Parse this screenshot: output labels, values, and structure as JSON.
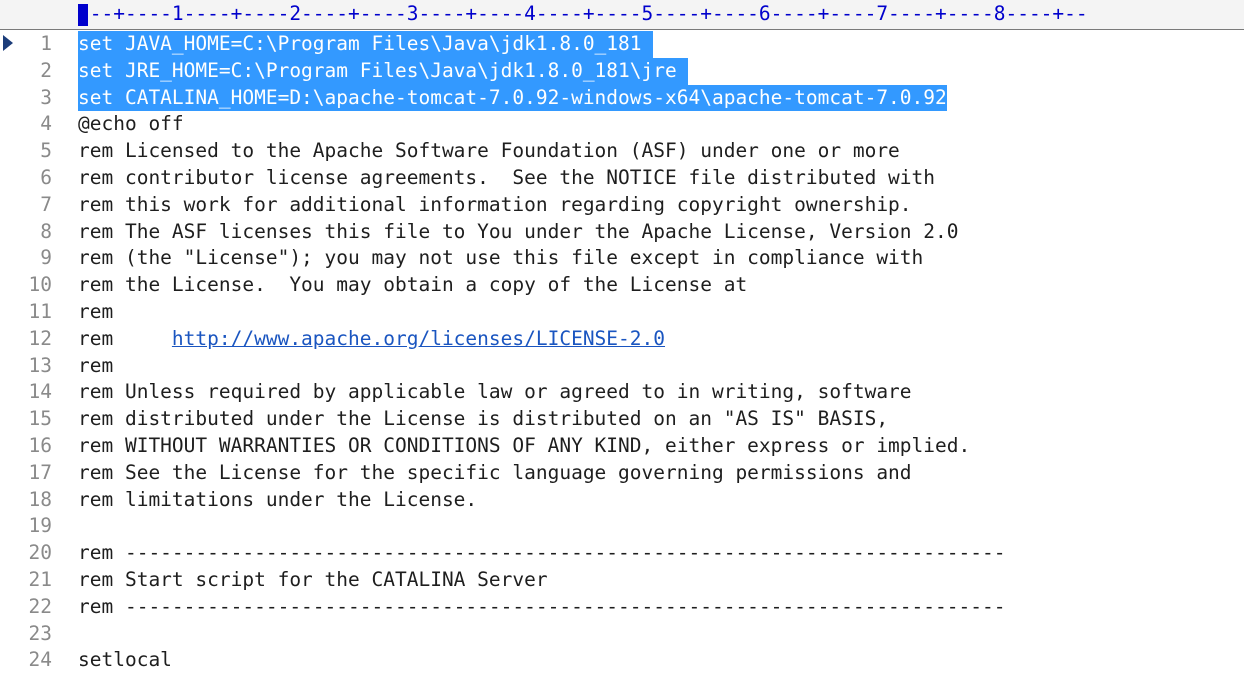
{
  "ruler": {
    "text": "---+----1----+----2----+----3----+----4----+----5----+----6----+----7----+----8----+--"
  },
  "lines": [
    {
      "num": "1",
      "text": "set JAVA_HOME=C:\\Program Files\\Java\\jdk1.8.0_181 ",
      "selected": true
    },
    {
      "num": "2",
      "text": "set JRE_HOME=C:\\Program Files\\Java\\jdk1.8.0_181\\jre ",
      "selected": true
    },
    {
      "num": "3",
      "text": "set CATALINA_HOME=D:\\apache-tomcat-7.0.92-windows-x64\\apache-tomcat-7.0.92",
      "selected": true
    },
    {
      "num": "4",
      "text": "@echo off"
    },
    {
      "num": "5",
      "text": "rem Licensed to the Apache Software Foundation (ASF) under one or more"
    },
    {
      "num": "6",
      "text": "rem contributor license agreements.  See the NOTICE file distributed with"
    },
    {
      "num": "7",
      "text": "rem this work for additional information regarding copyright ownership."
    },
    {
      "num": "8",
      "text": "rem The ASF licenses this file to You under the Apache License, Version 2.0"
    },
    {
      "num": "9",
      "text": "rem (the \"License\"); you may not use this file except in compliance with"
    },
    {
      "num": "10",
      "text": "rem the License.  You may obtain a copy of the License at"
    },
    {
      "num": "11",
      "text": "rem"
    },
    {
      "num": "12",
      "text": "rem     ",
      "link": "http://www.apache.org/licenses/LICENSE-2.0"
    },
    {
      "num": "13",
      "text": "rem"
    },
    {
      "num": "14",
      "text": "rem Unless required by applicable law or agreed to in writing, software"
    },
    {
      "num": "15",
      "text": "rem distributed under the License is distributed on an \"AS IS\" BASIS,"
    },
    {
      "num": "16",
      "text": "rem WITHOUT WARRANTIES OR CONDITIONS OF ANY KIND, either express or implied."
    },
    {
      "num": "17",
      "text": "rem See the License for the specific language governing permissions and"
    },
    {
      "num": "18",
      "text": "rem limitations under the License."
    },
    {
      "num": "19",
      "text": ""
    },
    {
      "num": "20",
      "text": "rem ---------------------------------------------------------------------------"
    },
    {
      "num": "21",
      "text": "rem Start script for the CATALINA Server"
    },
    {
      "num": "22",
      "text": "rem ---------------------------------------------------------------------------"
    },
    {
      "num": "23",
      "text": ""
    },
    {
      "num": "24",
      "text": "setlocal"
    }
  ]
}
